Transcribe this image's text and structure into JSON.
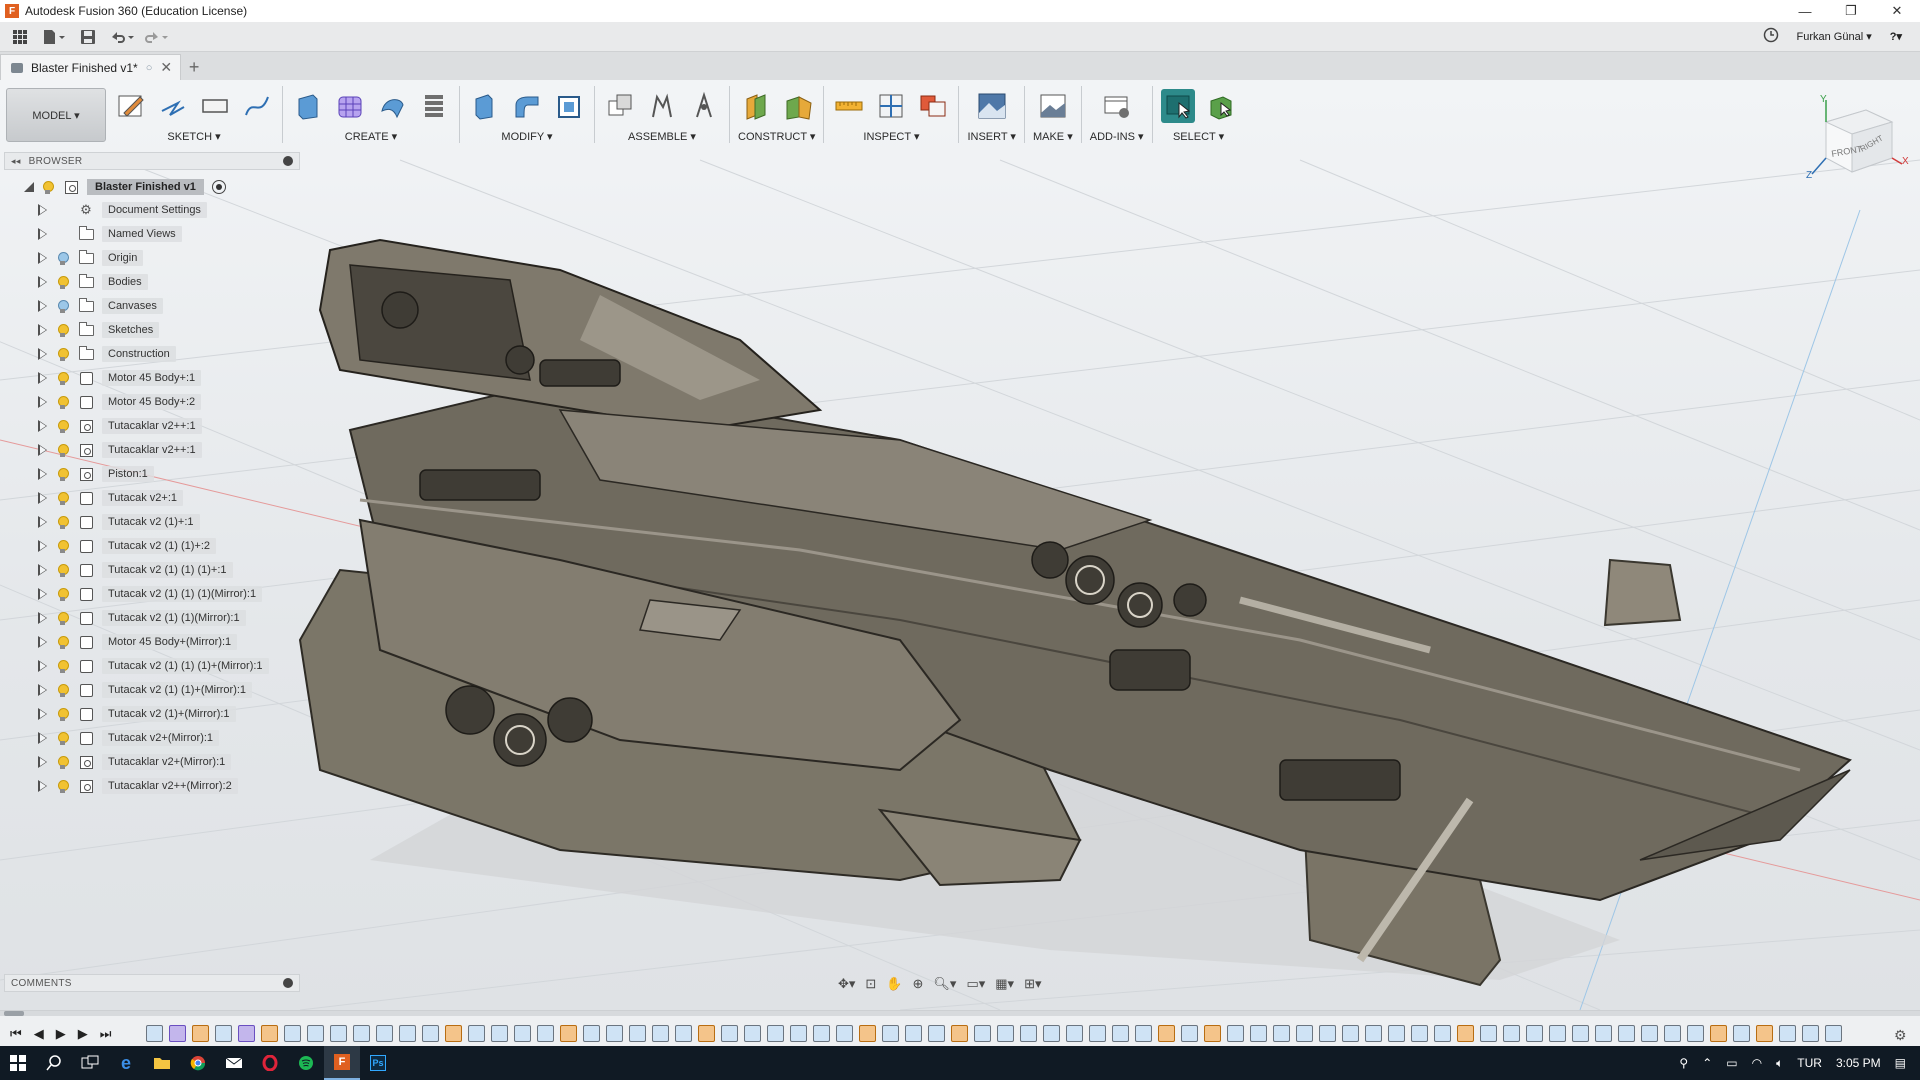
{
  "window": {
    "title": "Autodesk Fusion 360 (Education License)",
    "minimize": "—",
    "maximize": "❐",
    "close": "✕"
  },
  "quick_access": {
    "user_name": "Furkan Günal ▾",
    "help": "?▾"
  },
  "doc_tab": {
    "title": "Blaster Finished v1*",
    "close": "✕",
    "new_tab": "+"
  },
  "ribbon": {
    "workspace": "MODEL ▾",
    "groups": {
      "sketch": "SKETCH ▾",
      "create": "CREATE ▾",
      "modify": "MODIFY ▾",
      "assemble": "ASSEMBLE ▾",
      "construct": "CONSTRUCT ▾",
      "inspect": "INSPECT ▾",
      "insert": "INSERT ▾",
      "make": "MAKE ▾",
      "addins": "ADD-INS ▾",
      "select": "SELECT ▾"
    }
  },
  "browser": {
    "header": "BROWSER",
    "root": "Blaster Finished v1",
    "items": [
      {
        "label": "Document Settings",
        "icon": "gear-icon",
        "bulb": "none"
      },
      {
        "label": "Named Views",
        "icon": "folder-icon",
        "bulb": "none"
      },
      {
        "label": "Origin",
        "icon": "folder-icon",
        "bulb": "blue"
      },
      {
        "label": "Bodies",
        "icon": "folder-icon",
        "bulb": "yellow"
      },
      {
        "label": "Canvases",
        "icon": "folder-icon",
        "bulb": "blue"
      },
      {
        "label": "Sketches",
        "icon": "folder-icon",
        "bulb": "yellow"
      },
      {
        "label": "Construction",
        "icon": "folder-icon",
        "bulb": "yellow"
      },
      {
        "label": "Motor 45 Body+:1",
        "icon": "component-icon",
        "bulb": "yellow"
      },
      {
        "label": "Motor 45 Body+:2",
        "icon": "component-icon",
        "bulb": "yellow"
      },
      {
        "label": "Tutacaklar v2++:1",
        "icon": "linked-component-icon",
        "bulb": "yellow"
      },
      {
        "label": "Tutacaklar v2++:1",
        "icon": "linked-component-icon",
        "bulb": "yellow"
      },
      {
        "label": "Piston:1",
        "icon": "linked-component-icon",
        "bulb": "yellow"
      },
      {
        "label": "Tutacak v2+:1",
        "icon": "component-icon",
        "bulb": "yellow"
      },
      {
        "label": "Tutacak v2 (1)+:1",
        "icon": "component-icon",
        "bulb": "yellow"
      },
      {
        "label": "Tutacak v2 (1) (1)+:2",
        "icon": "component-icon",
        "bulb": "yellow"
      },
      {
        "label": "Tutacak v2 (1) (1) (1)+:1",
        "icon": "component-icon",
        "bulb": "yellow"
      },
      {
        "label": "Tutacak v2 (1) (1) (1)(Mirror):1",
        "icon": "component-icon",
        "bulb": "yellow"
      },
      {
        "label": "Tutacak v2 (1) (1)(Mirror):1",
        "icon": "component-icon",
        "bulb": "yellow"
      },
      {
        "label": "Motor 45 Body+(Mirror):1",
        "icon": "component-icon",
        "bulb": "yellow"
      },
      {
        "label": "Tutacak v2 (1) (1) (1)+(Mirror):1",
        "icon": "component-icon",
        "bulb": "yellow"
      },
      {
        "label": "Tutacak v2 (1) (1)+(Mirror):1",
        "icon": "component-icon",
        "bulb": "yellow"
      },
      {
        "label": "Tutacak v2 (1)+(Mirror):1",
        "icon": "component-icon",
        "bulb": "yellow"
      },
      {
        "label": "Tutacak v2+(Mirror):1",
        "icon": "component-icon",
        "bulb": "yellow"
      },
      {
        "label": "Tutacaklar v2+(Mirror):1",
        "icon": "linked-component-icon",
        "bulb": "yellow"
      },
      {
        "label": "Tutacaklar v2++(Mirror):2",
        "icon": "linked-component-icon",
        "bulb": "yellow"
      }
    ]
  },
  "comments": {
    "header": "COMMENTS"
  },
  "viewcube": {
    "front": "FRONT",
    "right": "RIGHT",
    "axis_x": "X",
    "axis_y": "Y",
    "axis_z": "Z"
  },
  "taskbar": {
    "language": "TUR",
    "time": "3:05 PM"
  },
  "colors": {
    "viewport_bg": "#eceff1",
    "model_body": "#6f6a5e",
    "taskbar_bg": "#101a24",
    "accent_select": "#2d8a8a"
  }
}
